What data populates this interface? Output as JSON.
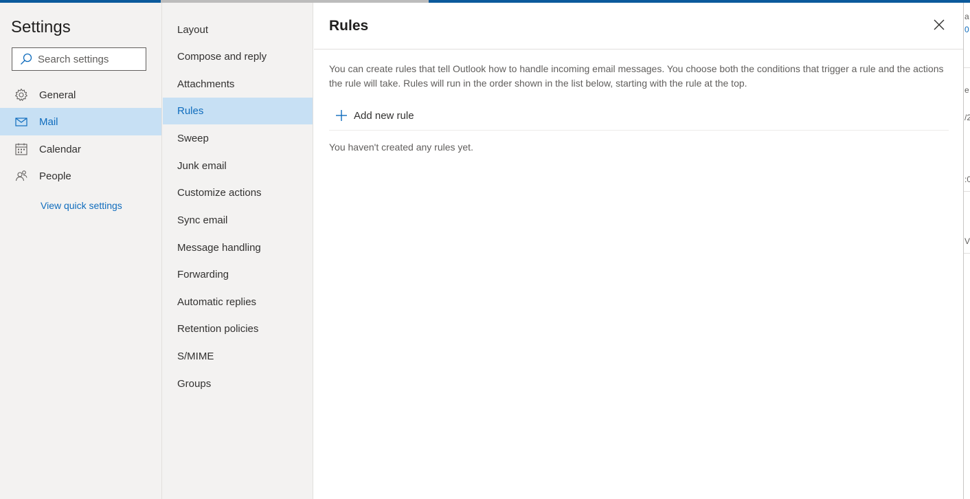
{
  "colors": {
    "accent": "#0f6cbd",
    "selected_bg": "#c7e0f4",
    "nav_bg": "#f3f2f1",
    "top_strip": "#0b5a9c"
  },
  "sidebar": {
    "title": "Settings",
    "search_placeholder": "Search settings",
    "items": [
      {
        "label": "General",
        "icon": "gear-icon"
      },
      {
        "label": "Mail",
        "icon": "mail-icon",
        "selected": true
      },
      {
        "label": "Calendar",
        "icon": "calendar-icon"
      },
      {
        "label": "People",
        "icon": "people-icon"
      }
    ],
    "quick_settings_link": "View quick settings"
  },
  "subnav": {
    "items": [
      {
        "label": "Layout"
      },
      {
        "label": "Compose and reply"
      },
      {
        "label": "Attachments"
      },
      {
        "label": "Rules",
        "selected": true
      },
      {
        "label": "Sweep"
      },
      {
        "label": "Junk email"
      },
      {
        "label": "Customize actions"
      },
      {
        "label": "Sync email"
      },
      {
        "label": "Message handling"
      },
      {
        "label": "Forwarding"
      },
      {
        "label": "Automatic replies"
      },
      {
        "label": "Retention policies"
      },
      {
        "label": "S/MIME"
      },
      {
        "label": "Groups"
      }
    ]
  },
  "main": {
    "title": "Rules",
    "description": "You can create rules that tell Outlook how to handle incoming email messages. You choose both the conditions that trigger a rule and the actions the rule will take. Rules will run in the order shown in the list below, starting with the rule at the top.",
    "add_rule_label": "Add new rule",
    "empty_message": "You haven't created any rules yet."
  },
  "background_fragments": [
    "a",
    "0",
    "e",
    "/2",
    ":0",
    "Ve"
  ]
}
